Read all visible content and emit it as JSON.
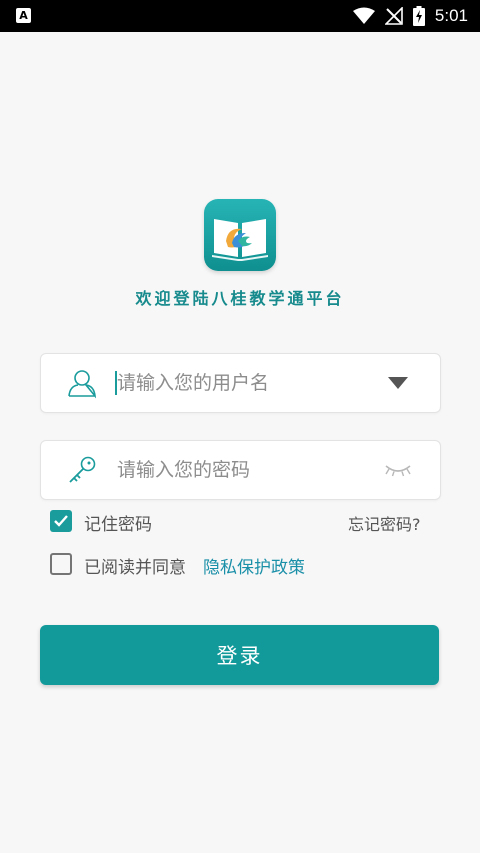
{
  "status_bar": {
    "notification_icon": "A",
    "time": "5:01",
    "icons": [
      "wifi-icon",
      "no-signal-icon",
      "battery-charging-icon"
    ]
  },
  "app": {
    "logo_icon": "book-logo-icon",
    "slogan": "欢迎登陆八桂教学通平台"
  },
  "username": {
    "placeholder": "请输入您的用户名",
    "icon": "user-icon",
    "dropdown_icon": "dropdown-arrow-icon"
  },
  "password": {
    "placeholder": "请输入您的密码",
    "icon": "key-icon",
    "toggle_icon": "eye-closed-icon"
  },
  "remember": {
    "label": "记住密码",
    "checked": true
  },
  "forgot_label": "忘记密码?",
  "agreement": {
    "label": "已阅读并同意",
    "link": "隐私保护政策",
    "checked": false
  },
  "login_button": "登录",
  "colors": {
    "accent": "#12999a",
    "link": "#1a8fa8",
    "background": "#f7f7f7"
  }
}
